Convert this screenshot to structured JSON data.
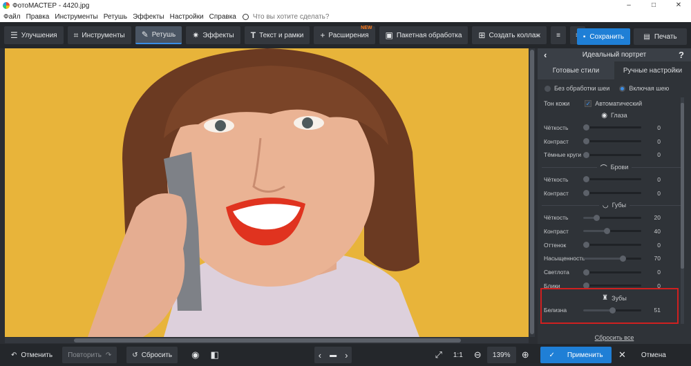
{
  "window": {
    "title": "ФотоМАСТЕР - 4420.jpg",
    "controls": [
      "–",
      "□",
      "✕"
    ]
  },
  "menu": {
    "items": [
      "Файл",
      "Правка",
      "Инструменты",
      "Ретушь",
      "Эффекты",
      "Настройки",
      "Справка"
    ],
    "search_placeholder": "Что вы хотите сделать?"
  },
  "toolbar": {
    "tabs": [
      {
        "label": "Улучшения",
        "icon": "sliders-icon"
      },
      {
        "label": "Инструменты",
        "icon": "crop-icon"
      },
      {
        "label": "Ретушь",
        "icon": "brush-icon",
        "active": true
      },
      {
        "label": "Эффекты",
        "icon": "sparkle-icon"
      },
      {
        "label": "Текст и рамки",
        "icon": "text-icon"
      },
      {
        "label": "Расширения",
        "icon": "plus-icon",
        "badge": "NEW"
      },
      {
        "label": "Пакетная обработка",
        "icon": "image-stack-icon"
      },
      {
        "label": "Создать коллаж",
        "icon": "collage-icon"
      }
    ],
    "save": "Сохранить",
    "print": "Печать"
  },
  "bottom": {
    "undo": "Отменить",
    "redo": "Повторить",
    "reset": "Сбросить",
    "ratio": "1:1",
    "zoom": "139%"
  },
  "panel": {
    "title": "Идеальный портрет",
    "tabs": [
      "Готовые стили",
      "Ручные настройки"
    ],
    "active_tab": 1,
    "radio_no_neck": "Без обработки шеи",
    "radio_with_neck": "Включая шею",
    "skin_tone_label": "Тон кожи",
    "skin_tone_auto": "Автоматический",
    "eyes": {
      "title": "Глаза",
      "rows": [
        {
          "name": "Чёткость",
          "value": 0
        },
        {
          "name": "Контраст",
          "value": 0
        },
        {
          "name": "Тёмные круги",
          "value": 0
        }
      ]
    },
    "brows": {
      "title": "Брови",
      "rows": [
        {
          "name": "Чёткость",
          "value": 0
        },
        {
          "name": "Контраст",
          "value": 0
        }
      ]
    },
    "lips": {
      "title": "Губы",
      "rows": [
        {
          "name": "Чёткость",
          "value": 20
        },
        {
          "name": "Контраст",
          "value": 40
        },
        {
          "name": "Оттенок",
          "value": 0
        },
        {
          "name": "Насыщенность",
          "value": 70
        },
        {
          "name": "Светлота",
          "value": 0
        },
        {
          "name": "Блики",
          "value": 0
        }
      ]
    },
    "teeth": {
      "title": "Зубы",
      "rows": [
        {
          "name": "Белизна",
          "value": 51
        }
      ]
    },
    "reset_all": "Сбросить все",
    "apply": "Применить",
    "cancel": "Отмена"
  }
}
